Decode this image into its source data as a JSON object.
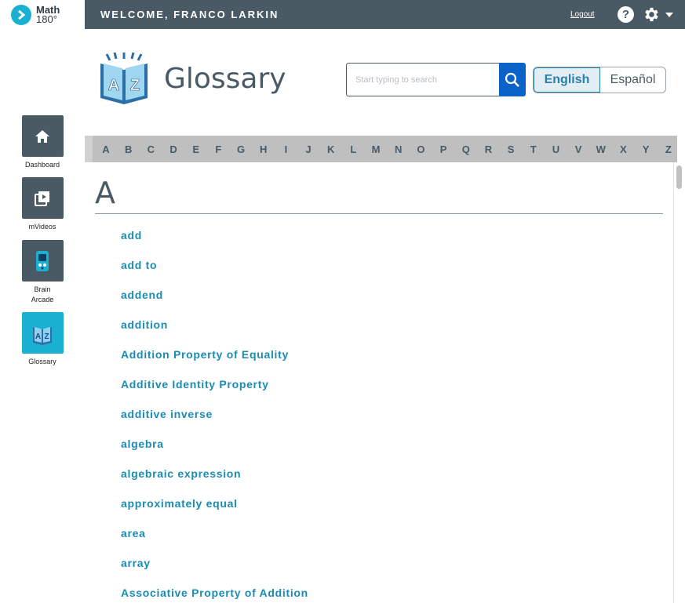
{
  "app": {
    "logo_line1": "Math",
    "logo_line2": "180°"
  },
  "topbar": {
    "welcome": "WELCOME, FRANCO LARKIN",
    "logout": "Logout",
    "help_glyph": "?"
  },
  "sidebar": {
    "items": [
      {
        "label": "Dashboard",
        "icon": "home-icon"
      },
      {
        "label": "mVideos",
        "icon": "video-library-icon"
      },
      {
        "label": "Brain Arcade",
        "icon": "brain-arcade-icon"
      },
      {
        "label": "Glossary",
        "icon": "glossary-book-icon",
        "active": true
      }
    ]
  },
  "header": {
    "title": "Glossary",
    "book_letters": [
      "A",
      "Z"
    ]
  },
  "search": {
    "placeholder": "Start typing to search",
    "value": ""
  },
  "language": {
    "options": [
      "English",
      "Español"
    ],
    "selected": "English"
  },
  "alphabet": [
    "A",
    "B",
    "C",
    "D",
    "E",
    "F",
    "G",
    "H",
    "I",
    "J",
    "K",
    "L",
    "M",
    "N",
    "O",
    "P",
    "Q",
    "R",
    "S",
    "T",
    "U",
    "V",
    "W",
    "X",
    "Y",
    "Z"
  ],
  "section": {
    "letter": "A",
    "terms": [
      "add",
      "add to",
      "addend",
      "addition",
      "Addition Property of Equality",
      "Additive Identity Property",
      "additive inverse",
      "algebra",
      "algebraic expression",
      "approximately equal",
      "area",
      "array",
      "Associative Property of Addition"
    ]
  },
  "colors": {
    "topbar": "#4a5a64",
    "accent": "#1ab0d1",
    "search_button": "#0a63c9",
    "link": "#1a8cb4"
  }
}
